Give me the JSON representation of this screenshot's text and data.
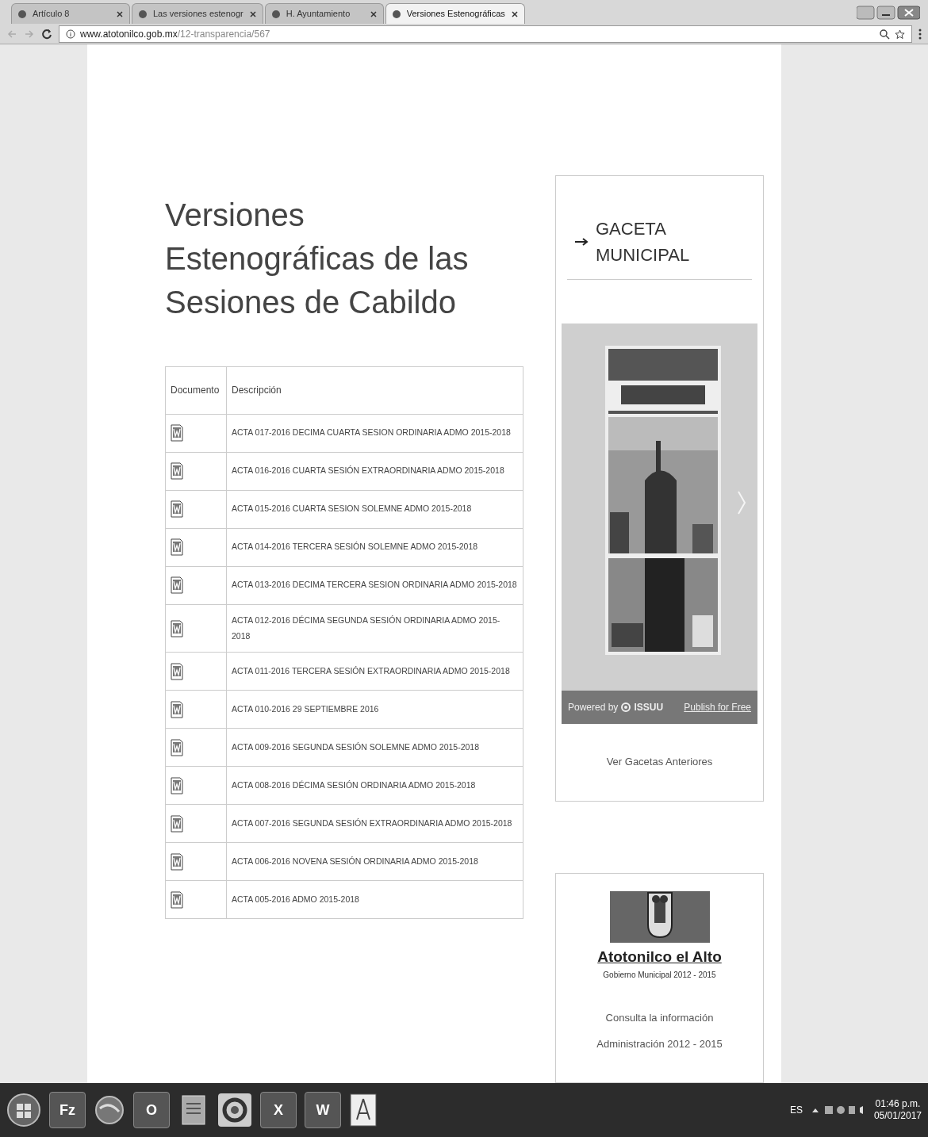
{
  "browser": {
    "tabs": [
      {
        "title": "Artículo 8",
        "selected": false
      },
      {
        "title": "Las versiones estenogr",
        "selected": false
      },
      {
        "title": "H. Ayuntamiento",
        "selected": false
      },
      {
        "title": "Versiones Estenográficas",
        "selected": true
      }
    ],
    "url_host": "www.atotonilco.gob.mx",
    "url_path": "/12-transparencia/567"
  },
  "page": {
    "title": "Versiones Estenográficas de las Sesiones de Cabildo",
    "table": {
      "columns": [
        "Documento",
        "Descripción"
      ],
      "rows": [
        {
          "description": "ACTA 017-2016 DECIMA CUARTA SESION ORDINARIA ADMO 2015-2018"
        },
        {
          "description": "ACTA 016-2016 CUARTA SESIÓN EXTRAORDINARIA ADMO 2015-2018"
        },
        {
          "description": "ACTA 015-2016 CUARTA SESION SOLEMNE ADMO 2015-2018"
        },
        {
          "description": "ACTA 014-2016 TERCERA SESIÓN SOLEMNE ADMO 2015-2018"
        },
        {
          "description": "ACTA 013-2016 DECIMA TERCERA SESION ORDINARIA ADMO 2015-2018"
        },
        {
          "description": "ACTA 012-2016 DÉCIMA SEGUNDA SESIÓN ORDINARIA ADMO 2015-2018"
        },
        {
          "description": "ACTA 011-2016 TERCERA SESIÓN EXTRAORDINARIA ADMO 2015-2018"
        },
        {
          "description": "ACTA 010-2016 29 SEPTIEMBRE 2016"
        },
        {
          "description": "ACTA 009-2016 SEGUNDA SESIÓN SOLEMNE ADMO 2015-2018"
        },
        {
          "description": "ACTA 008-2016 DÉCIMA SESIÓN ORDINARIA ADMO 2015-2018"
        },
        {
          "description": "ACTA 007-2016 SEGUNDA SESIÓN EXTRAORDINARIA ADMO 2015-2018"
        },
        {
          "description": "ACTA 006-2016 NOVENA SESIÓN ORDINARIA ADMO 2015-2018"
        },
        {
          "description": "ACTA 005-2016 ADMO 2015-2018"
        }
      ]
    }
  },
  "sidebar": {
    "gaceta": {
      "heading": "GACETA MUNICIPAL",
      "embed": {
        "powered_by": "Powered by",
        "brand": "ISSUU",
        "publish_link": "Publish for Free"
      },
      "link": "Ver Gacetas Anteriores"
    },
    "admin": {
      "logo_name": "Atotonilco el Alto",
      "logo_subtitle": "Gobierno Municipal 2012 - 2015",
      "text_lines": [
        "Consulta la información",
        "Administración 2012 - 2015"
      ]
    }
  },
  "taskbar": {
    "apps": [
      {
        "kind": "start"
      },
      {
        "kind": "letter",
        "glyph": "Fz"
      },
      {
        "kind": "globe"
      },
      {
        "kind": "letter",
        "glyph": "O"
      },
      {
        "kind": "notes"
      },
      {
        "kind": "ring"
      },
      {
        "kind": "letter",
        "glyph": "X"
      },
      {
        "kind": "letter",
        "glyph": "W"
      },
      {
        "kind": "acrobat"
      }
    ],
    "language": "ES",
    "time": "01:46 p.m.",
    "date": "05/01/2017"
  }
}
